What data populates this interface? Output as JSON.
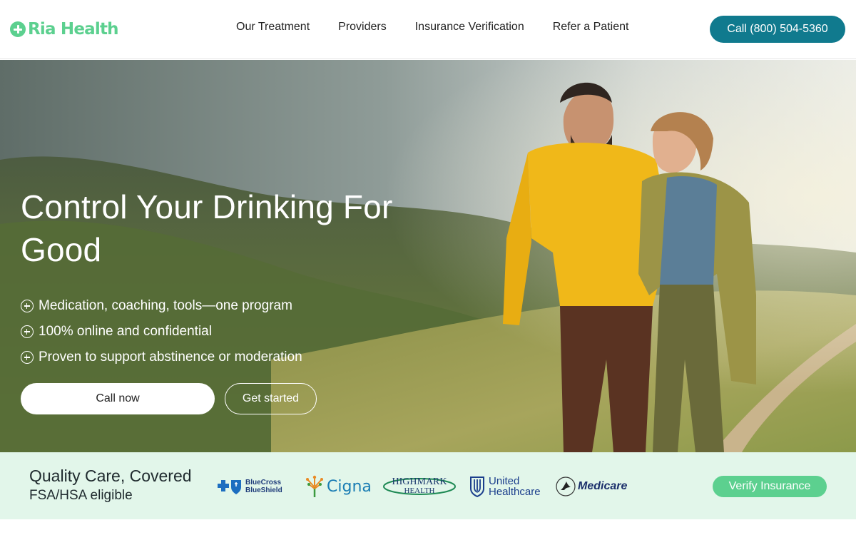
{
  "brand": {
    "name": "Ria Health",
    "logo_icon": "plus-circle-icon",
    "color": "#5cd08f"
  },
  "nav": {
    "items": [
      {
        "label": "Our Treatment"
      },
      {
        "label": "Providers"
      },
      {
        "label": "Insurance Verification"
      },
      {
        "label": "Refer a Patient"
      }
    ],
    "call_label": "Call (800) 504-5360",
    "call_color": "#107a8e"
  },
  "hero": {
    "title": "Control Your Drinking For Good",
    "bullets": [
      {
        "text": "Medication, coaching, tools—one program",
        "icon": "plus-circle-icon"
      },
      {
        "text": "100% online and confidential",
        "icon": "plus-circle-icon"
      },
      {
        "text": "Proven to support abstinence or moderation",
        "icon": "plus-circle-icon"
      }
    ],
    "call_now_label": "Call now",
    "get_started_label": "Get started"
  },
  "insurance": {
    "title": "Quality Care, Covered",
    "subtitle": "FSA/HSA eligible",
    "logos": [
      {
        "name": "BlueCross BlueShield",
        "line1": "BlueCross",
        "line2": "BlueShield"
      },
      {
        "name": "Cigna",
        "text": "Cigna"
      },
      {
        "name": "Highmark Health",
        "line1": "HIGHMARK",
        "line2": "HEALTH"
      },
      {
        "name": "United Healthcare",
        "line1": "United",
        "line2": "Healthcare"
      },
      {
        "name": "Medicare",
        "text": "Medicare"
      }
    ],
    "verify_label": "Verify Insurance",
    "band_color": "#e2f6ea"
  }
}
